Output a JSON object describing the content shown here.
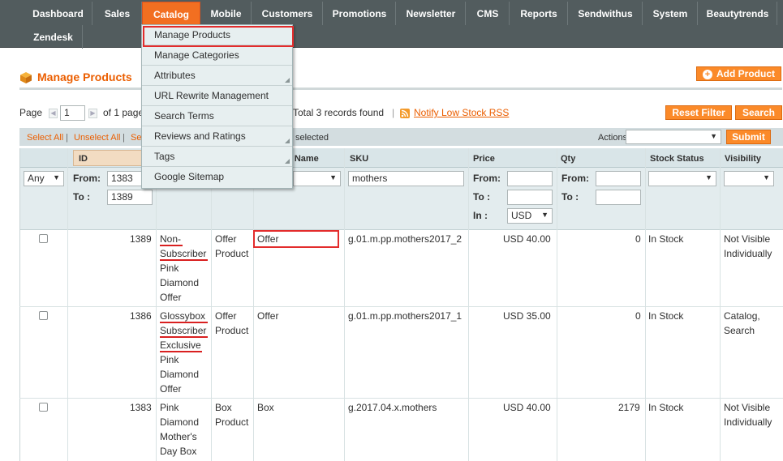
{
  "nav": {
    "items": [
      "Dashboard",
      "Sales",
      "Catalog",
      "Mobile",
      "Customers",
      "Promotions",
      "Newsletter",
      "CMS",
      "Reports",
      "Sendwithus",
      "System",
      "Beautytrends"
    ],
    "second_row": [
      "Zendesk"
    ],
    "active": "Catalog"
  },
  "dropdown": {
    "items": [
      "Manage Products",
      "Manage Categories",
      "Attributes",
      "URL Rewrite Management",
      "Search Terms",
      "Reviews and Ratings",
      "Tags",
      "Google Sitemap"
    ]
  },
  "header": {
    "title": "Manage Products",
    "add_button": "Add Product"
  },
  "pager": {
    "page_label": "Page",
    "page_value": "1",
    "of_pages": "of 1 page",
    "total": "Total 3 records found",
    "separator": "|",
    "rss_link": "Notify Low Stock RSS",
    "reset_filter": "Reset Filter",
    "search": "Search"
  },
  "massaction": {
    "select_all": "Select All",
    "unselect_all": "Unselect All",
    "select_visible": "Se",
    "sep": "|",
    "selected": "selected",
    "actions_label": "Actions",
    "actions_value": "",
    "submit": "Submit"
  },
  "columns": {
    "id": "ID",
    "set_name": "et Name",
    "sku": "SKU",
    "price": "Price",
    "qty": "Qty",
    "stock_status": "Stock Status",
    "visibility": "Visibility"
  },
  "filters": {
    "massaction_any": "Any",
    "id_from_label": "From:",
    "id_from": "1383",
    "id_to_label": "To :",
    "id_to": "1389",
    "sku": "mothers",
    "price_from_label": "From:",
    "price_to_label": "To :",
    "price_in_label": "In :",
    "price_currency": "USD",
    "qty_from_label": "From:",
    "qty_to_label": "To :",
    "price_from": "",
    "price_to": "",
    "qty_from": "",
    "qty_to": ""
  },
  "rows": [
    {
      "id": "1389",
      "name": [
        "Non-",
        "Subscriber",
        "Pink",
        "Diamond",
        "Offer"
      ],
      "type": [
        "Offer",
        "Product"
      ],
      "set": "Offer",
      "sku": "g.01.m.pp.mothers2017_2",
      "price": "USD 40.00",
      "qty": "0",
      "stock": "In Stock",
      "visibility": [
        "Not Visible",
        "Individually"
      ]
    },
    {
      "id": "1386",
      "name": [
        "Glossybox",
        "Subscriber",
        "Exclusive",
        "Pink",
        "Diamond",
        "Offer"
      ],
      "type": [
        "Offer",
        "Product"
      ],
      "set": "Offer",
      "sku": "g.01.m.pp.mothers2017_1",
      "price": "USD 35.00",
      "qty": "0",
      "stock": "In Stock",
      "visibility": [
        "Catalog,",
        "Search"
      ]
    },
    {
      "id": "1383",
      "name": [
        "Pink",
        "Diamond",
        "Mother's",
        "Day Box"
      ],
      "type": [
        "Box",
        "Product"
      ],
      "set": "Box",
      "sku": "g.2017.04.x.mothers",
      "price": "USD 40.00",
      "qty": "2179",
      "stock": "In Stock",
      "visibility": [
        "Not Visible",
        "Individually"
      ]
    }
  ],
  "colors": {
    "nav": "#525c5e",
    "accent": "#eb5e00",
    "active_tab": "#f26f21",
    "highlight": "#e32c2c"
  }
}
